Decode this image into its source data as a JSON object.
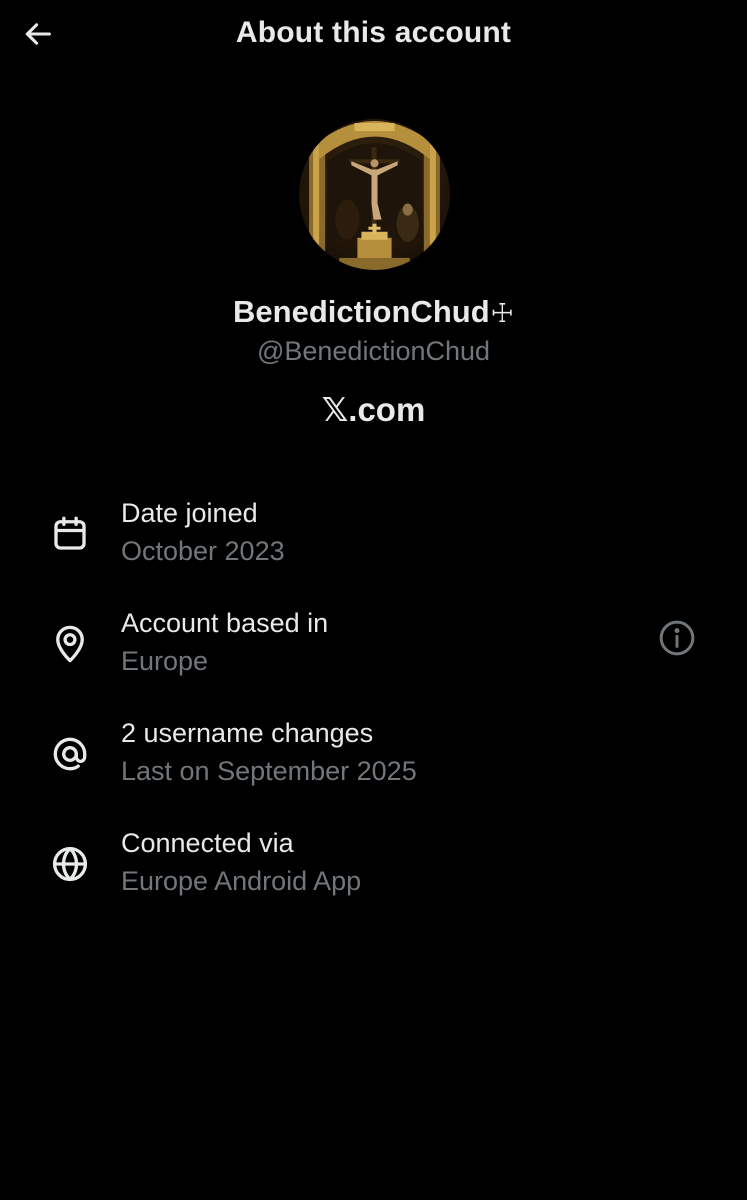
{
  "header": {
    "title": "About this account",
    "back_icon": "arrow-left-icon"
  },
  "profile": {
    "display_name": "BenedictionChud",
    "name_emoji": "☩",
    "handle": "@BenedictionChud",
    "site": "𝕏.com",
    "avatar_icon": "crucifixion-painting-avatar"
  },
  "details": [
    {
      "icon": "calendar-icon",
      "label": "Date joined",
      "value": "October 2023"
    },
    {
      "icon": "location-pin-icon",
      "label": "Account based in",
      "value": "Europe",
      "info_icon": "info-icon"
    },
    {
      "icon": "at-sign-icon",
      "label": "2 username changes",
      "value": "Last on September 2025"
    },
    {
      "icon": "globe-icon",
      "label": "Connected via",
      "value": "Europe Android App"
    }
  ],
  "colors": {
    "background": "#000000",
    "primary_text": "#e7e9ea",
    "secondary_text": "#71767b"
  }
}
